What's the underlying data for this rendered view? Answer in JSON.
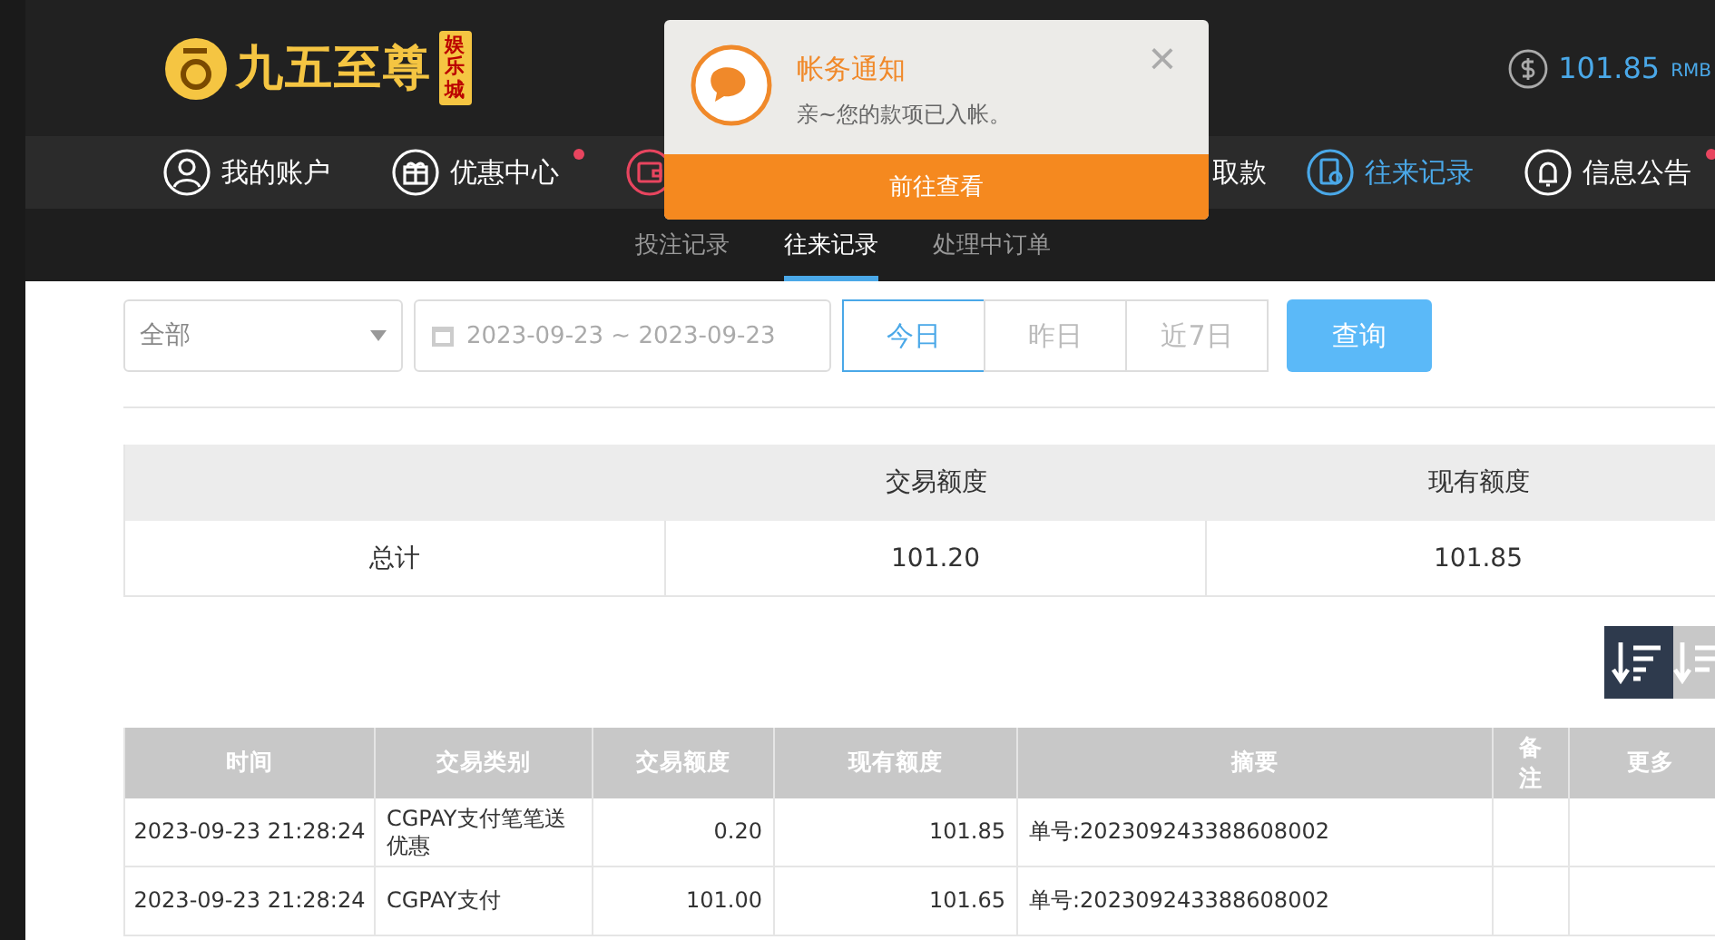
{
  "header": {
    "logo_text": "九五至尊",
    "logo_badge": "娱乐城",
    "balance": "101.85",
    "currency": "RMB"
  },
  "nav": [
    {
      "kind": "item",
      "label": "我的账户",
      "selected": false
    },
    {
      "kind": "item",
      "label": "优惠中心",
      "dot": true,
      "selected": false
    },
    {
      "kind": "icon"
    },
    {
      "kind": "item",
      "label": "取款",
      "selected": false
    },
    {
      "kind": "item",
      "label": "往来记录",
      "selected": true
    },
    {
      "kind": "item",
      "label": "信息公告",
      "dot": true,
      "selected": false
    }
  ],
  "subtabs": [
    {
      "label": "投注记录",
      "selected": false
    },
    {
      "label": "往来记录",
      "selected": true
    },
    {
      "label": "处理中订单",
      "selected": false
    }
  ],
  "filters": {
    "type_select": "全部",
    "date_range": "2023-09-23 ~ 2023-09-23",
    "ranges": [
      {
        "label": "今日",
        "selected": true
      },
      {
        "label": "昨日",
        "selected": false
      },
      {
        "label": "近7日",
        "selected": false
      }
    ],
    "search_button": "查询"
  },
  "summary": {
    "columns": [
      "",
      "交易额度",
      "现有额度"
    ],
    "rows": [
      [
        "总计",
        "101.20",
        "101.85"
      ]
    ]
  },
  "table": {
    "columns": [
      "时间",
      "交易类别",
      "交易额度",
      "现有额度",
      "摘要",
      "备注",
      "更多"
    ],
    "rows": [
      [
        "2023-09-23 21:28:24",
        "CGPAY支付笔笔送优惠",
        "0.20",
        "101.85",
        "单号:202309243388608002",
        "",
        ""
      ],
      [
        "2023-09-23 21:28:24",
        "CGPAY支付",
        "101.00",
        "101.65",
        "单号:202309243388608002",
        "",
        ""
      ]
    ]
  },
  "notification": {
    "title": "帐务通知",
    "message": "亲~您的款项已入帐。",
    "close": "×",
    "action": "前往查看"
  }
}
